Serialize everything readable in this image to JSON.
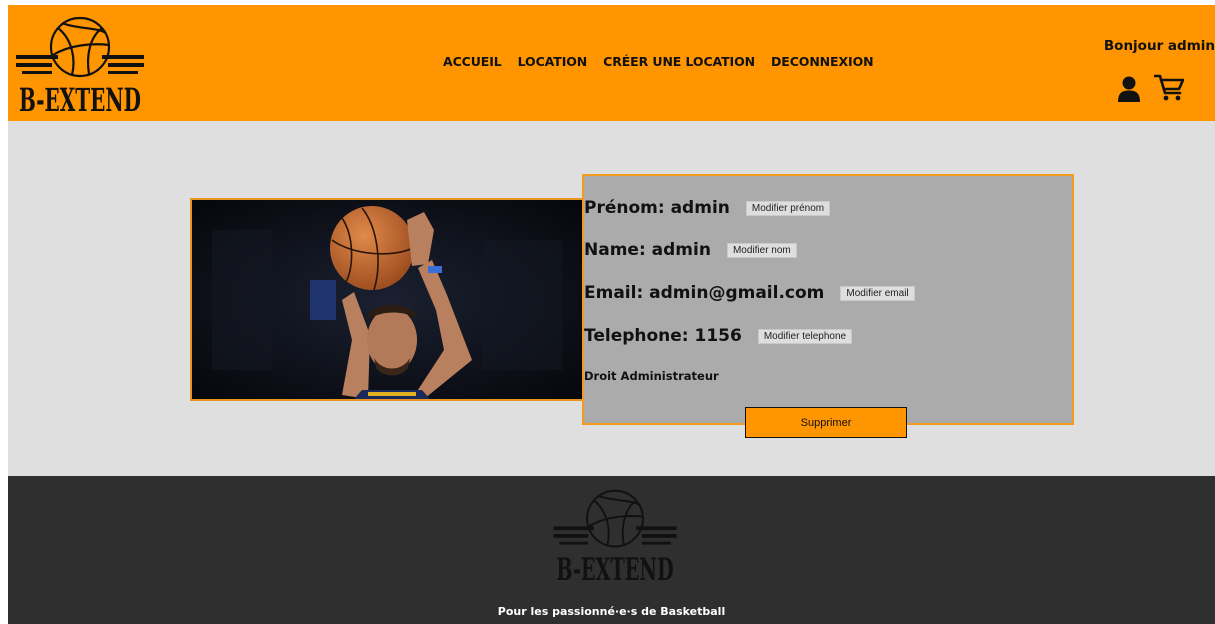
{
  "header": {
    "brand": "B-EXTEND",
    "nav": [
      "ACCUEIL",
      "LOCATION",
      "CRÉER UNE LOCATION",
      "DECONNEXION"
    ],
    "greeting": "Bonjour admin",
    "icons": [
      "user-icon",
      "cart-icon"
    ]
  },
  "profile": {
    "fields": [
      {
        "label": "Prénom: admin",
        "button": "Modifier prénom"
      },
      {
        "label": "Name: admin",
        "button": "Modifier nom"
      },
      {
        "label": "Email: admin@gmail.com",
        "button": "Modifier email"
      },
      {
        "label": "Telephone: 1156",
        "button": "Modifier telephone"
      }
    ],
    "role": "Droit Administrateur",
    "delete_label": "Supprimer"
  },
  "footer": {
    "brand": "B-EXTEND",
    "tagline": "Pour les passionné·e·s de Basketball"
  },
  "colors": {
    "accent": "#ff9500",
    "page_background": "#dfdfdf",
    "card_background": "#ababab",
    "footer_background": "#2f2f2f"
  }
}
